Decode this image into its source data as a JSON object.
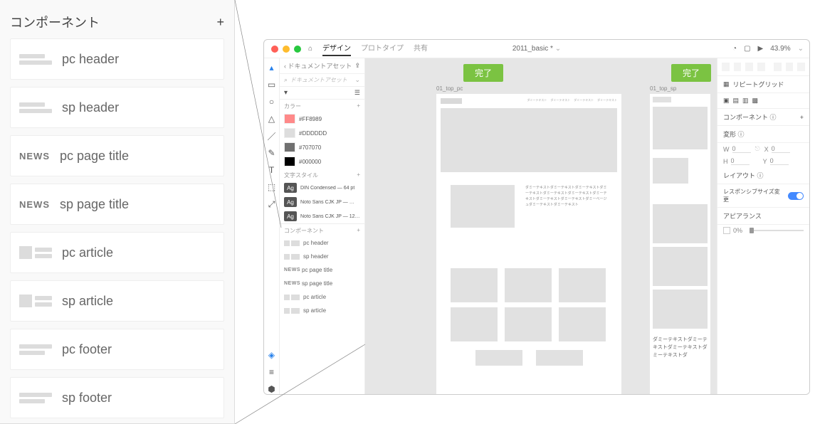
{
  "zoom_panel": {
    "title": "コンポーネント",
    "items": [
      {
        "label": "pc header",
        "type": "header"
      },
      {
        "label": "sp header",
        "type": "header"
      },
      {
        "label": "pc page title",
        "type": "news"
      },
      {
        "label": "sp page title",
        "type": "news"
      },
      {
        "label": "pc article",
        "type": "article"
      },
      {
        "label": "sp article",
        "type": "article"
      },
      {
        "label": "pc footer",
        "type": "footer"
      },
      {
        "label": "sp footer",
        "type": "footer"
      }
    ]
  },
  "titlebar": {
    "tabs": {
      "design": "デザイン",
      "prototype": "プロトタイプ",
      "share": "共有"
    },
    "doc": "2011_basic *",
    "zoom": "43.9%"
  },
  "assets": {
    "back": "ドキュメントアセット",
    "search_placeholder": "ドキュメントアセット",
    "section_color": "カラー",
    "section_charstyle": "文字スタイル",
    "section_component": "コンポーネント",
    "colors": [
      "#FF8989",
      "#DDDDDD",
      "#707070",
      "#000000"
    ],
    "styles": [
      "DIN Condensed — 64 pt",
      "Noto Sans CJK JP — …",
      "Noto Sans CJK JP — 12…"
    ],
    "components": [
      "pc header",
      "sp header",
      "pc page title",
      "sp page title",
      "pc article",
      "sp article"
    ],
    "news_tag": "NEWS"
  },
  "canvas": {
    "badge_text": "完了",
    "art_labels": {
      "pc": "01_top_pc",
      "sp": "01_top_sp"
    },
    "sp_copy": "ダミーテキストダミーテキストダミーテキストダミーテキストダ",
    "pc_dummy": "ダミーテキストダミーテキストダミーテキストダミーテキストダミーテキストダミーテキストダミーテキストダミーテキストダミーテキストダミーベージュダミーテキストダミーテキスト"
  },
  "props": {
    "repeat": "リピートグリッド",
    "component_label": "コンポーネント",
    "transform_label": "変形",
    "w": "W",
    "h": "H",
    "x": "X",
    "y": "Y",
    "zero": "0",
    "layout_label": "レイアウト",
    "responsive_label": "レスポンシブサイズ変更",
    "appearance_label": "アピアランス",
    "opacity": "0%",
    "info_icon": "ⓘ"
  }
}
